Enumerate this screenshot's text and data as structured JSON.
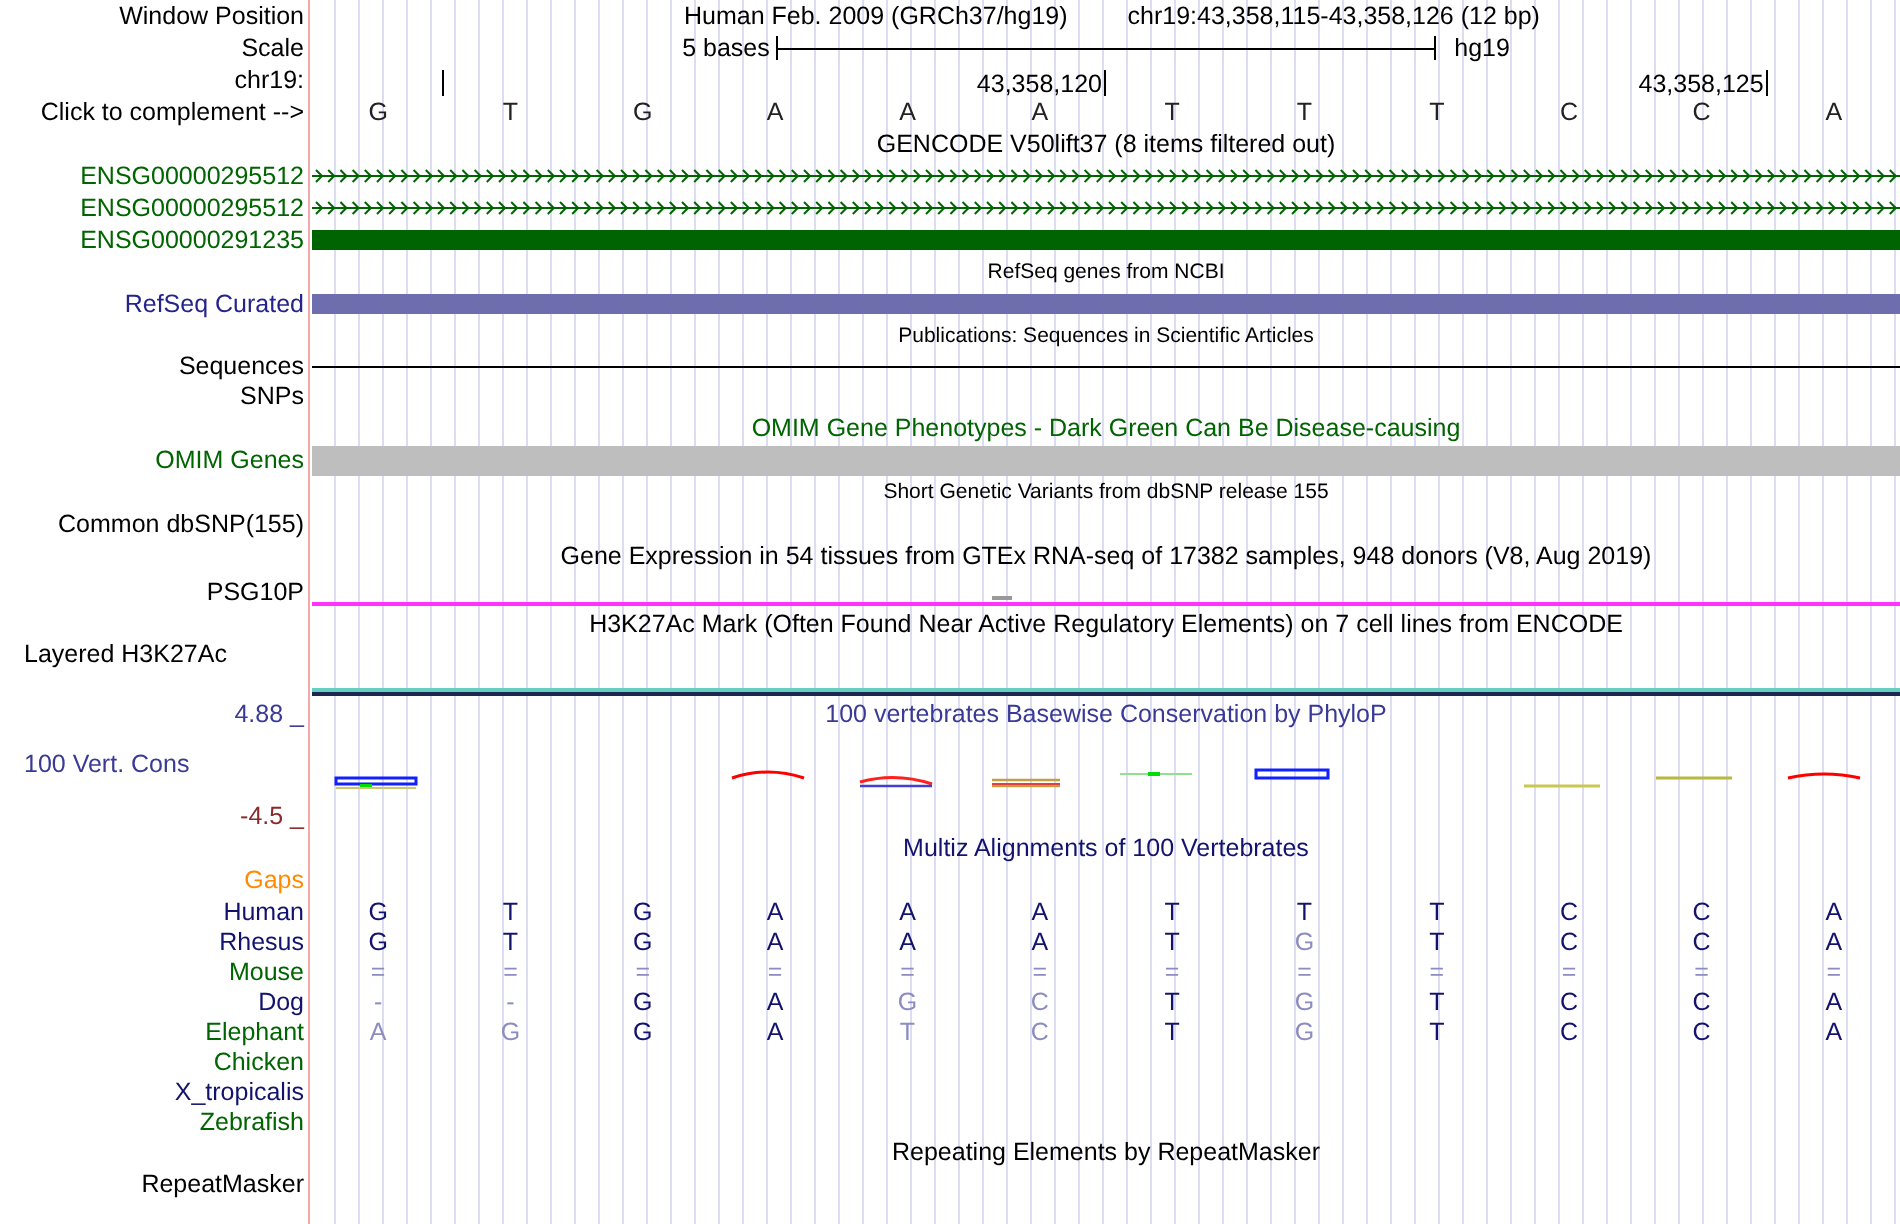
{
  "header": {
    "label": "Window Position",
    "assembly": "Human Feb. 2009 (GRCh37/hg19)",
    "position": "chr19:43,358,115-43,358,126 (12 bp)"
  },
  "scale": {
    "label": "Scale",
    "bar_label": "5 bases",
    "assembly": "hg19"
  },
  "ruler": {
    "label": "chr19:",
    "ticks": [
      "43,358,120",
      "43,358,125"
    ]
  },
  "sequence": {
    "label": "Click to complement -->",
    "bases": [
      "G",
      "T",
      "G",
      "A",
      "A",
      "A",
      "T",
      "T",
      "T",
      "C",
      "C",
      "A"
    ]
  },
  "tracks": [
    {
      "kind": "title",
      "text": "GENCODE V50lift37 (8 items filtered out)",
      "color": "#000000"
    },
    {
      "kind": "gencode-arrows",
      "label": "ENSG00000295512",
      "color": "#006400"
    },
    {
      "kind": "gencode-arrows",
      "label": "ENSG00000295512",
      "color": "#006400"
    },
    {
      "kind": "gencode-bar",
      "label": "ENSG00000291235",
      "color": "#006400"
    },
    {
      "kind": "caption",
      "text": "RefSeq genes from NCBI",
      "color": "#000000"
    },
    {
      "kind": "refseq",
      "label": "RefSeq Curated",
      "color": "#24248c"
    },
    {
      "kind": "caption",
      "text": "Publications: Sequences in Scientific Articles",
      "color": "#000000"
    },
    {
      "kind": "line",
      "label": "Sequences",
      "color": "#000000"
    },
    {
      "kind": "empty",
      "label": "SNPs",
      "color": "#000000"
    },
    {
      "kind": "title",
      "text": "OMIM Gene Phenotypes - Dark Green Can Be Disease-causing",
      "color": "#006400"
    },
    {
      "kind": "omim",
      "label": "OMIM Genes",
      "color": "#006400"
    },
    {
      "kind": "caption",
      "text": "Short Genetic Variants from dbSNP release 155",
      "color": "#000000"
    },
    {
      "kind": "empty",
      "label": "Common dbSNP(155)",
      "color": "#000000"
    },
    {
      "kind": "title",
      "text": "Gene Expression in 54 tissues from GTEx RNA-seq of 17382 samples, 948 donors (V8, Aug 2019)",
      "color": "#000000"
    },
    {
      "kind": "expression",
      "label": "PSG10P",
      "color": "#000000"
    },
    {
      "kind": "title",
      "text": "H3K27Ac Mark (Often Found Near Active Regulatory Elements) on 7 cell lines from ENCODE",
      "color": "#000000"
    },
    {
      "kind": "signal",
      "label": "Layered H3K27Ac",
      "color": "#000000"
    },
    {
      "kind": "conservation",
      "title": "100 vertebrates Basewise Conservation by PhyloP",
      "label": "100 Vert. Cons",
      "max": "4.88 _",
      "min": "-4.5 _",
      "color": "#3a3a96"
    },
    {
      "kind": "title",
      "text": "Multiz Alignments of 100 Vertebrates",
      "color": "#13136e"
    },
    {
      "kind": "empty",
      "label": "Gaps",
      "color": "#ff8c00"
    },
    {
      "kind": "alignment",
      "label": "Human",
      "color": "#13136e",
      "bases": [
        {
          "b": "G",
          "faint": false
        },
        {
          "b": "T",
          "faint": false
        },
        {
          "b": "G",
          "faint": false
        },
        {
          "b": "A",
          "faint": false
        },
        {
          "b": "A",
          "faint": false
        },
        {
          "b": "A",
          "faint": false
        },
        {
          "b": "T",
          "faint": false
        },
        {
          "b": "T",
          "faint": false
        },
        {
          "b": "T",
          "faint": false
        },
        {
          "b": "C",
          "faint": false
        },
        {
          "b": "C",
          "faint": false
        },
        {
          "b": "A",
          "faint": false
        }
      ]
    },
    {
      "kind": "alignment",
      "label": "Rhesus",
      "color": "#13136e",
      "bases": [
        {
          "b": "G",
          "faint": false
        },
        {
          "b": "T",
          "faint": false
        },
        {
          "b": "G",
          "faint": false
        },
        {
          "b": "A",
          "faint": false
        },
        {
          "b": "A",
          "faint": false
        },
        {
          "b": "A",
          "faint": false
        },
        {
          "b": "T",
          "faint": false
        },
        {
          "b": "G",
          "faint": true
        },
        {
          "b": "T",
          "faint": false
        },
        {
          "b": "C",
          "faint": false
        },
        {
          "b": "C",
          "faint": false
        },
        {
          "b": "A",
          "faint": false
        }
      ]
    },
    {
      "kind": "alignment",
      "label": "Mouse",
      "color": "#006400",
      "bases": [
        {
          "b": "=",
          "faint": true
        },
        {
          "b": "=",
          "faint": true
        },
        {
          "b": "=",
          "faint": true
        },
        {
          "b": "=",
          "faint": true
        },
        {
          "b": "=",
          "faint": true
        },
        {
          "b": "=",
          "faint": true
        },
        {
          "b": "=",
          "faint": true
        },
        {
          "b": "=",
          "faint": true
        },
        {
          "b": "=",
          "faint": true
        },
        {
          "b": "=",
          "faint": true
        },
        {
          "b": "=",
          "faint": true
        },
        {
          "b": "=",
          "faint": true
        }
      ]
    },
    {
      "kind": "alignment",
      "label": "Dog",
      "color": "#13136e",
      "bases": [
        {
          "b": "-",
          "faint": true
        },
        {
          "b": "-",
          "faint": true
        },
        {
          "b": "G",
          "faint": false
        },
        {
          "b": "A",
          "faint": false
        },
        {
          "b": "G",
          "faint": true
        },
        {
          "b": "C",
          "faint": true
        },
        {
          "b": "T",
          "faint": false
        },
        {
          "b": "G",
          "faint": true
        },
        {
          "b": "T",
          "faint": false
        },
        {
          "b": "C",
          "faint": false
        },
        {
          "b": "C",
          "faint": false
        },
        {
          "b": "A",
          "faint": false
        }
      ]
    },
    {
      "kind": "alignment",
      "label": "Elephant",
      "color": "#006400",
      "bases": [
        {
          "b": "A",
          "faint": true
        },
        {
          "b": "G",
          "faint": true
        },
        {
          "b": "G",
          "faint": false
        },
        {
          "b": "A",
          "faint": false
        },
        {
          "b": "T",
          "faint": true
        },
        {
          "b": "C",
          "faint": true
        },
        {
          "b": "T",
          "faint": false
        },
        {
          "b": "G",
          "faint": true
        },
        {
          "b": "T",
          "faint": false
        },
        {
          "b": "C",
          "faint": false
        },
        {
          "b": "C",
          "faint": false
        },
        {
          "b": "A",
          "faint": false
        }
      ]
    },
    {
      "kind": "empty",
      "label": "Chicken",
      "color": "#006400"
    },
    {
      "kind": "empty",
      "label": "X_tropicalis",
      "color": "#13136e"
    },
    {
      "kind": "empty",
      "label": "Zebrafish",
      "color": "#006400"
    },
    {
      "kind": "title",
      "text": "Repeating Elements by RepeatMasker",
      "color": "#000000"
    },
    {
      "kind": "empty",
      "label": "RepeatMasker",
      "color": "#000000"
    }
  ]
}
